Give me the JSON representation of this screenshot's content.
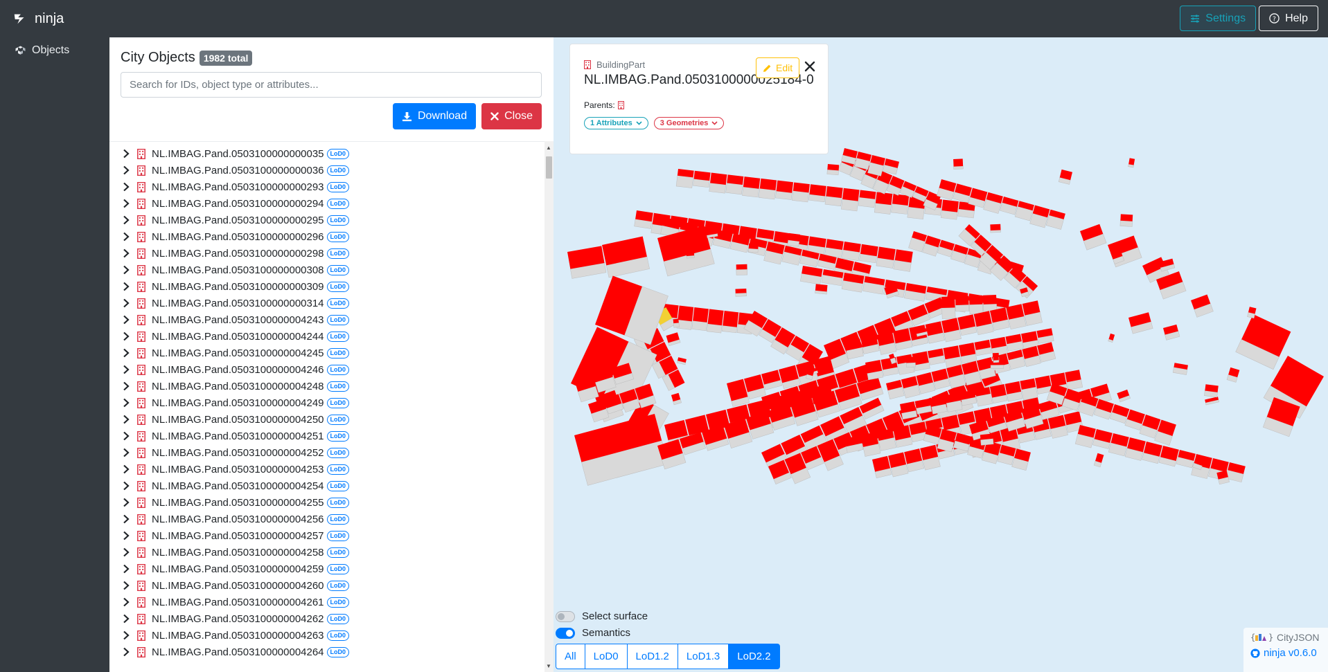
{
  "navbar": {
    "brand": "ninja",
    "settings_label": "Settings",
    "help_label": "Help"
  },
  "sidebar": {
    "items": [
      {
        "label": "Objects",
        "icon": "objects-icon"
      }
    ]
  },
  "objects_panel": {
    "title": "City Objects",
    "total_badge": "1982 total",
    "search_placeholder": "Search for IDs, object type or attributes...",
    "download_label": "Download",
    "close_label": "Close",
    "items": [
      {
        "id": "NL.IMBAG.Pand.0503100000000035",
        "lod": "LoD0"
      },
      {
        "id": "NL.IMBAG.Pand.0503100000000036",
        "lod": "LoD0"
      },
      {
        "id": "NL.IMBAG.Pand.0503100000000293",
        "lod": "LoD0"
      },
      {
        "id": "NL.IMBAG.Pand.0503100000000294",
        "lod": "LoD0"
      },
      {
        "id": "NL.IMBAG.Pand.0503100000000295",
        "lod": "LoD0"
      },
      {
        "id": "NL.IMBAG.Pand.0503100000000296",
        "lod": "LoD0"
      },
      {
        "id": "NL.IMBAG.Pand.0503100000000298",
        "lod": "LoD0"
      },
      {
        "id": "NL.IMBAG.Pand.0503100000000308",
        "lod": "LoD0"
      },
      {
        "id": "NL.IMBAG.Pand.0503100000000309",
        "lod": "LoD0"
      },
      {
        "id": "NL.IMBAG.Pand.0503100000000314",
        "lod": "LoD0"
      },
      {
        "id": "NL.IMBAG.Pand.0503100000004243",
        "lod": "LoD0"
      },
      {
        "id": "NL.IMBAG.Pand.0503100000004244",
        "lod": "LoD0"
      },
      {
        "id": "NL.IMBAG.Pand.0503100000004245",
        "lod": "LoD0"
      },
      {
        "id": "NL.IMBAG.Pand.0503100000004246",
        "lod": "LoD0"
      },
      {
        "id": "NL.IMBAG.Pand.0503100000004248",
        "lod": "LoD0"
      },
      {
        "id": "NL.IMBAG.Pand.0503100000004249",
        "lod": "LoD0"
      },
      {
        "id": "NL.IMBAG.Pand.0503100000004250",
        "lod": "LoD0"
      },
      {
        "id": "NL.IMBAG.Pand.0503100000004251",
        "lod": "LoD0"
      },
      {
        "id": "NL.IMBAG.Pand.0503100000004252",
        "lod": "LoD0"
      },
      {
        "id": "NL.IMBAG.Pand.0503100000004253",
        "lod": "LoD0"
      },
      {
        "id": "NL.IMBAG.Pand.0503100000004254",
        "lod": "LoD0"
      },
      {
        "id": "NL.IMBAG.Pand.0503100000004255",
        "lod": "LoD0"
      },
      {
        "id": "NL.IMBAG.Pand.0503100000004256",
        "lod": "LoD0"
      },
      {
        "id": "NL.IMBAG.Pand.0503100000004257",
        "lod": "LoD0"
      },
      {
        "id": "NL.IMBAG.Pand.0503100000004258",
        "lod": "LoD0"
      },
      {
        "id": "NL.IMBAG.Pand.0503100000004259",
        "lod": "LoD0"
      },
      {
        "id": "NL.IMBAG.Pand.0503100000004260",
        "lod": "LoD0"
      },
      {
        "id": "NL.IMBAG.Pand.0503100000004261",
        "lod": "LoD0"
      },
      {
        "id": "NL.IMBAG.Pand.0503100000004262",
        "lod": "LoD0"
      },
      {
        "id": "NL.IMBAG.Pand.0503100000004263",
        "lod": "LoD0"
      },
      {
        "id": "NL.IMBAG.Pand.0503100000004264",
        "lod": "LoD0"
      }
    ]
  },
  "info_card": {
    "type": "BuildingPart",
    "title": "NL.IMBAG.Pand.0503100000025184-0",
    "edit_label": "Edit",
    "parents_label": "Parents:",
    "attributes_chip": "1 Attributes",
    "geometries_chip": "3 Geometries"
  },
  "viewer": {
    "select_surface_label": "Select surface",
    "select_surface_on": false,
    "semantics_label": "Semantics",
    "semantics_on": true,
    "lod_buttons": [
      "All",
      "LoD0",
      "LoD1.2",
      "LoD1.3",
      "LoD2.2"
    ],
    "lod_active": "LoD2.2",
    "cityjson_label": "CityJSON",
    "version_label": "ninja v0.6.0"
  },
  "colors": {
    "navbar_bg": "#343a40",
    "viewer_bg": "#dbecf8",
    "roof_red": "#ff0000",
    "wall_grey": "#d9d9d9",
    "selected_yellow": "#f2d033",
    "primary": "#007bff",
    "danger": "#dc3545",
    "info": "#17a2b8",
    "warning": "#ffc107"
  }
}
